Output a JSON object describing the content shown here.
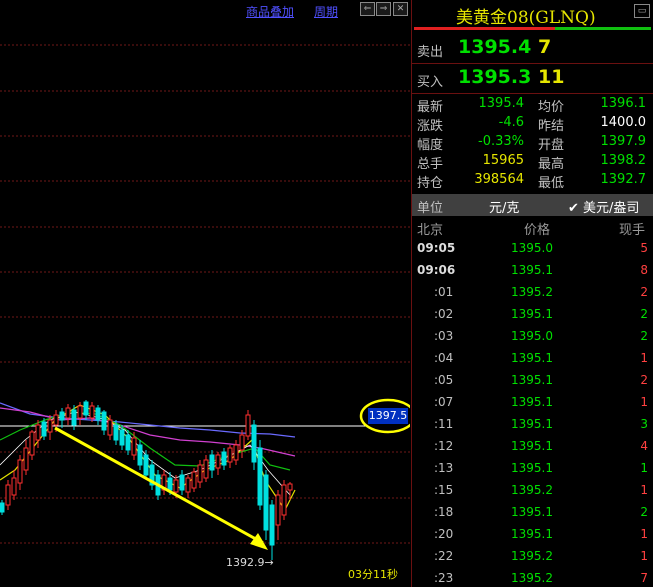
{
  "toolbar": {
    "overlay_label": "商品叠加",
    "period_label": "周期"
  },
  "chart": {
    "current_price_tag": "1397.5",
    "low_annotation": "1392.9→",
    "countdown": "03分11秒"
  },
  "quote": {
    "title": "美黄金08(GLNQ)",
    "sell": {
      "label": "卖出",
      "price": "1395.4",
      "volume": "7"
    },
    "buy": {
      "label": "买入",
      "price": "1395.3",
      "volume": "11"
    },
    "stats_left": [
      {
        "label": "最新",
        "value": "1395.4",
        "color": "#00e000"
      },
      {
        "label": "涨跌",
        "value": "-4.6",
        "color": "#00e000"
      },
      {
        "label": "幅度",
        "value": "-0.33%",
        "color": "#00e000"
      },
      {
        "label": "总手",
        "value": "15965",
        "color": "#e6e600"
      },
      {
        "label": "持仓",
        "value": "398564",
        "color": "#e6e600"
      }
    ],
    "stats_right": [
      {
        "label": "均价",
        "value": "1396.1",
        "color": "#00e000"
      },
      {
        "label": "昨结",
        "value": "1400.0",
        "color": "#ffffff"
      },
      {
        "label": "开盘",
        "value": "1397.9",
        "color": "#00e000"
      },
      {
        "label": "最高",
        "value": "1398.2",
        "color": "#00e000"
      },
      {
        "label": "最低",
        "value": "1392.7",
        "color": "#00e000"
      }
    ],
    "unit": {
      "label": "单位",
      "value": "元/克",
      "alt": "✔ 美元/盎司"
    },
    "ticks_header": {
      "time": "北京",
      "price": "价格",
      "vol": "现手"
    },
    "ticks": [
      {
        "time": "09:05",
        "price": "1395.0",
        "vol": "5",
        "vol_color": "#ff4040",
        "kind": "major"
      },
      {
        "time": "09:06",
        "price": "1395.1",
        "vol": "8",
        "vol_color": "#ff4040",
        "kind": "major"
      },
      {
        "time": ":01",
        "price": "1395.2",
        "vol": "2",
        "vol_color": "#ff4040",
        "kind": "minor"
      },
      {
        "time": ":02",
        "price": "1395.1",
        "vol": "2",
        "vol_color": "#00e000",
        "kind": "minor"
      },
      {
        "time": ":03",
        "price": "1395.0",
        "vol": "2",
        "vol_color": "#00e000",
        "kind": "minor"
      },
      {
        "time": ":04",
        "price": "1395.1",
        "vol": "1",
        "vol_color": "#ff4040",
        "kind": "minor"
      },
      {
        "time": ":05",
        "price": "1395.1",
        "vol": "2",
        "vol_color": "#ff4040",
        "kind": "minor"
      },
      {
        "time": ":07",
        "price": "1395.1",
        "vol": "1",
        "vol_color": "#ff4040",
        "kind": "minor"
      },
      {
        "time": ":11",
        "price": "1395.1",
        "vol": "3",
        "vol_color": "#00e000",
        "kind": "minor"
      },
      {
        "time": ":12",
        "price": "1395.1",
        "vol": "4",
        "vol_color": "#ff4040",
        "kind": "minor"
      },
      {
        "time": ":13",
        "price": "1395.1",
        "vol": "1",
        "vol_color": "#00e000",
        "kind": "minor"
      },
      {
        "time": ":15",
        "price": "1395.2",
        "vol": "1",
        "vol_color": "#ff4040",
        "kind": "minor"
      },
      {
        "time": ":18",
        "price": "1395.1",
        "vol": "2",
        "vol_color": "#00e000",
        "kind": "minor"
      },
      {
        "time": ":20",
        "price": "1395.1",
        "vol": "1",
        "vol_color": "#ff4040",
        "kind": "minor"
      },
      {
        "time": ":22",
        "price": "1395.2",
        "vol": "1",
        "vol_color": "#ff4040",
        "kind": "minor"
      },
      {
        "time": ":23",
        "price": "1395.2",
        "vol": "7",
        "vol_color": "#ff4040",
        "kind": "minor"
      }
    ]
  },
  "colors": {
    "up": "#ff4040",
    "down": "#00e000",
    "accent": "#e6e600"
  }
}
